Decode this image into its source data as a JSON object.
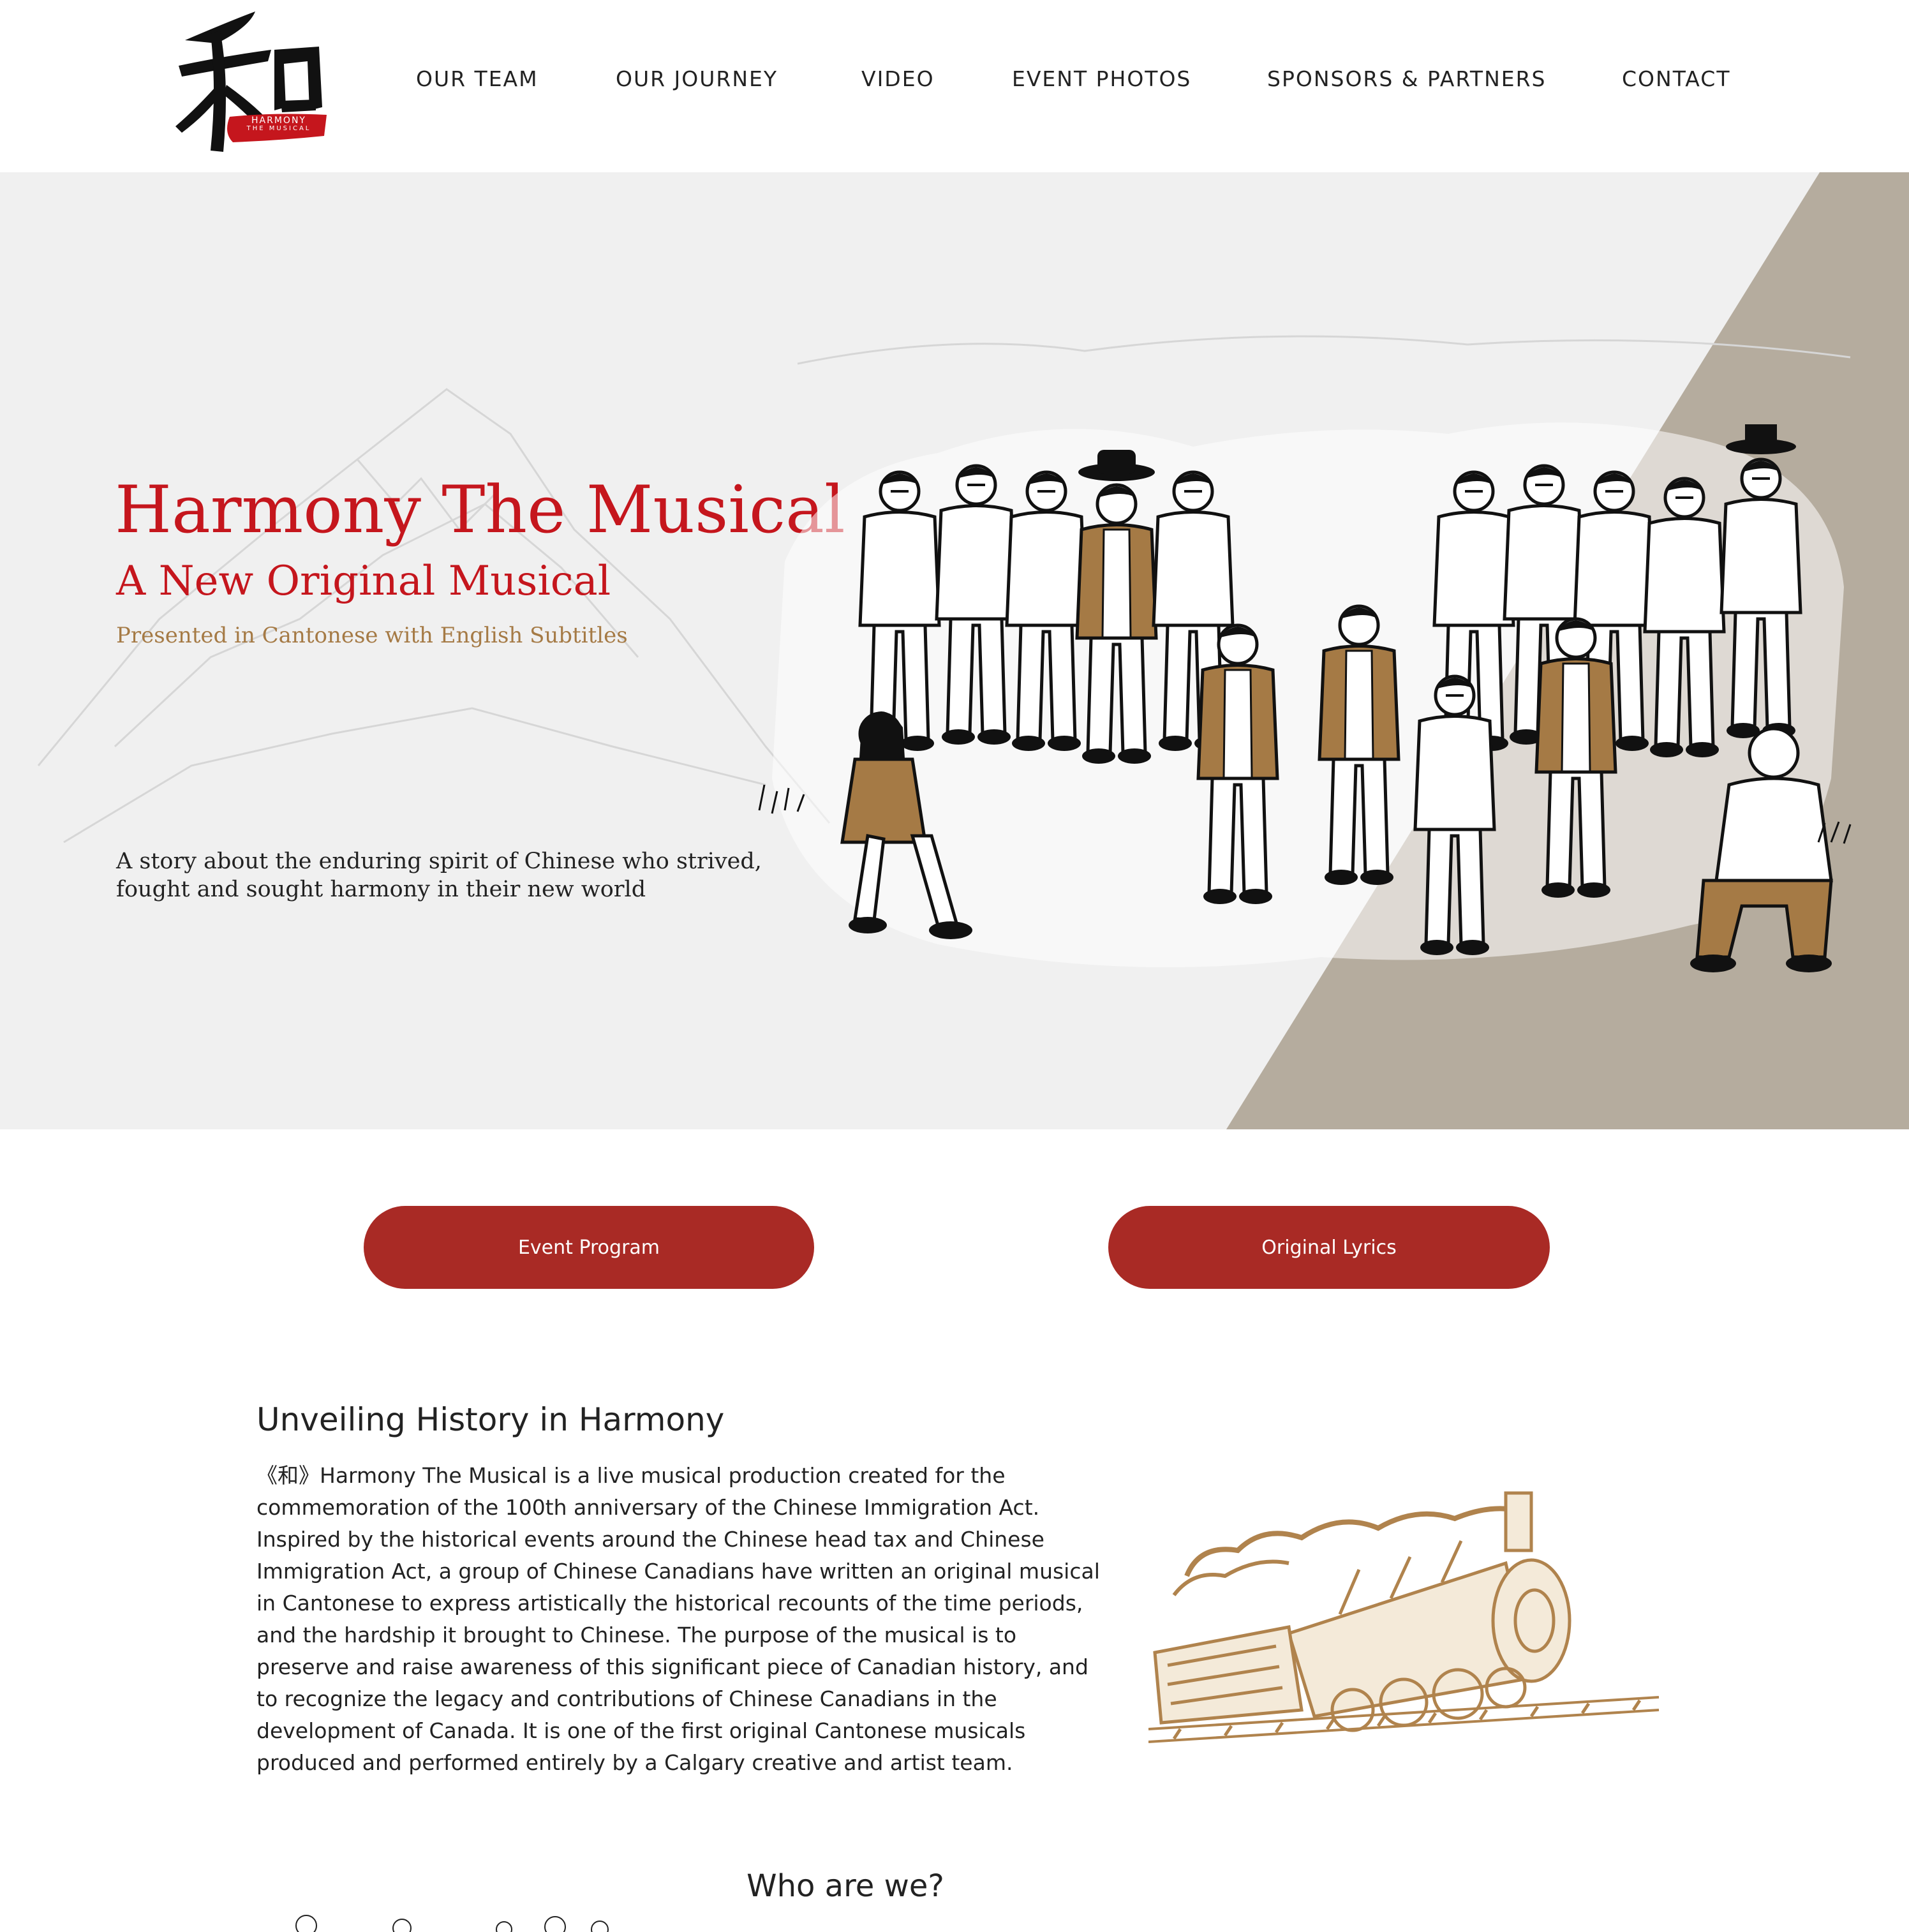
{
  "brand": {
    "logo_text_line1": "HARMONY",
    "logo_text_line2": "THE MUSICAL",
    "accent_red": "#c5161d",
    "button_red": "#a92a25",
    "gold": "#a57a45",
    "taupe": "#b5ac9e"
  },
  "nav": {
    "items": [
      {
        "label": "OUR TEAM"
      },
      {
        "label": "OUR JOURNEY"
      },
      {
        "label": "VIDEO"
      },
      {
        "label": "EVENT PHOTOS"
      },
      {
        "label": "SPONSORS & PARTNERS"
      },
      {
        "label": "CONTACT"
      }
    ]
  },
  "hero": {
    "title": "Harmony The Musical",
    "subtitle": "A New Original Musical",
    "note": "Presented in Cantonese with English Subtitles",
    "story": "A story about the enduring spirit of Chinese who strived, fought and sought harmony in their new world"
  },
  "actions": {
    "event_program": "Event Program",
    "original_lyrics": "Original Lyrics"
  },
  "about": {
    "title": "Unveiling History in Harmony",
    "body": "《和》Harmony The Musical is a live musical production created for the commemoration of the 100th anniversary of the Chinese Immigration Act. Inspired by the historical events around the Chinese head tax and Chinese Immigration Act, a group of Chinese Canadians have written an original musical in Cantonese to express artistically the historical recounts of the time periods, and the hardship it brought to Chinese. The purpose of the musical is to preserve and raise awareness of this significant piece of Canadian history, and to recognize the legacy and contributions of Chinese Canadians in the development of Canada. It is one of the first original Cantonese musicals produced and performed entirely by a Calgary creative and artist team."
  },
  "who": {
    "title": "Who are we?"
  }
}
